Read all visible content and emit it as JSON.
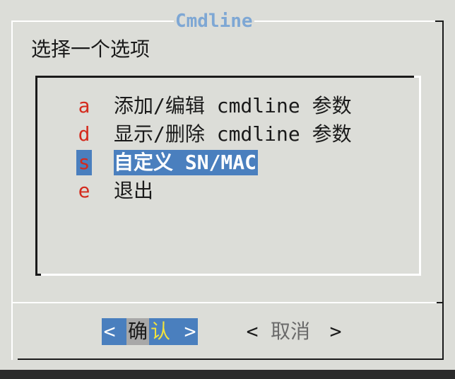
{
  "dialog": {
    "title": "Cmdline",
    "prompt": "选择一个选项"
  },
  "menu": {
    "items": [
      {
        "key": "a",
        "label": "添加/编辑 cmdline 参数",
        "selected": false
      },
      {
        "key": "d",
        "label": "显示/删除 cmdline 参数",
        "selected": false
      },
      {
        "key": "s",
        "label": "自定义 SN/MAC",
        "selected": true
      },
      {
        "key": "e",
        "label": "退出",
        "selected": false
      }
    ]
  },
  "buttons": {
    "ok": {
      "left": "<",
      "char1": "确",
      "char2": "认",
      "right": ">"
    },
    "cancel": {
      "left": "<",
      "label": "取消",
      "right": ">"
    }
  },
  "colors": {
    "background": "#dcddd8",
    "title": "#7ea7d4",
    "hotkey": "#d42b1e",
    "selection": "#4a7fbe",
    "button_hotkey": "#f2e33c"
  }
}
